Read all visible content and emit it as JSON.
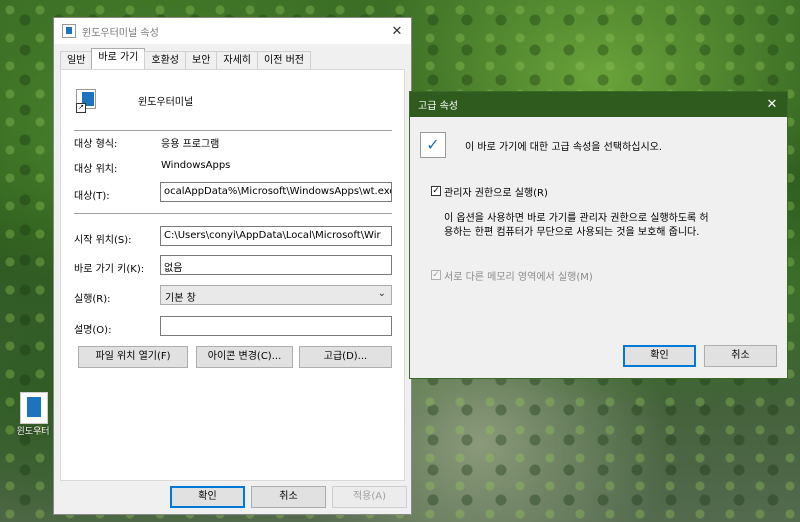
{
  "desktop": {
    "icon_label": "윈도우터"
  },
  "props": {
    "title": "윈도우터미널 속성",
    "close_glyph": "✕",
    "tabs": [
      "일반",
      "바로 가기",
      "호환성",
      "보안",
      "자세히",
      "이전 버전"
    ],
    "app_name": "윈도우터미널",
    "target_type_label": "대상 형식:",
    "target_type_value": "응용 프로그램",
    "target_location_label": "대상 위치:",
    "target_location_value": "WindowsApps",
    "target_label": "대상(T):",
    "target_value": "ocalAppData%\\Microsoft\\WindowsApps\\wt.exe",
    "start_in_label": "시작 위치(S):",
    "start_in_value": "C:\\Users\\conyi\\AppData\\Local\\Microsoft\\Wir",
    "shortcut_key_label": "바로 가기 키(K):",
    "shortcut_key_value": "없음",
    "run_label": "실행(R):",
    "run_value": "기본 창",
    "comment_label": "설명(O):",
    "comment_value": "",
    "btn_open_location": "파일 위치 열기(F)",
    "btn_change_icon": "아이콘 변경(C)...",
    "btn_advanced": "고급(D)...",
    "btn_ok": "확인",
    "btn_cancel": "취소",
    "btn_apply": "적용(A)"
  },
  "advanced": {
    "title": "고급 속성",
    "close_glyph": "✕",
    "description": "이 바로 가기에 대한 고급 속성을 선택하십시오.",
    "run_as_admin_label": "관리자 권한으로 실행(R)",
    "run_as_admin_checked": true,
    "run_as_admin_help_line1": "이 옵션을 사용하면 바로 가기를 관리자 권한으로 실행하도록 허",
    "run_as_admin_help_line2": "용하는 한편 컴퓨터가 무단으로 사용되는 것을 보호해 줍니다.",
    "separate_memory_label": "서로 다른 메모리 영역에서 실행(M)",
    "separate_memory_checked": true,
    "btn_ok": "확인",
    "btn_cancel": "취소"
  },
  "colors": {
    "accent": "#0078d7",
    "dialog_titlebar": "#2f5b1e"
  }
}
